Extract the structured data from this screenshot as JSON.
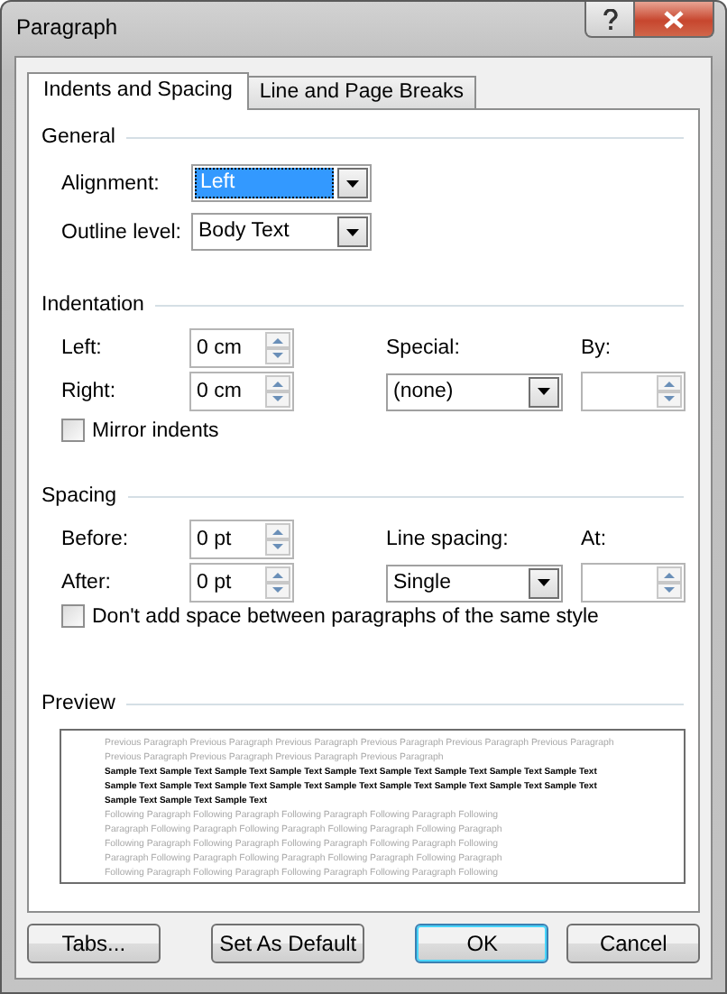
{
  "window": {
    "title": "Paragraph"
  },
  "tabs": [
    {
      "label": "Indents and Spacing",
      "selected": true
    },
    {
      "label": "Line and Page Breaks",
      "selected": false
    }
  ],
  "general": {
    "heading": "General",
    "alignment": {
      "label": "Alignment:",
      "value": "Left",
      "highlighted": true
    },
    "outline_level": {
      "label": "Outline level:",
      "value": "Body Text",
      "highlighted": false
    }
  },
  "indentation": {
    "heading": "Indentation",
    "left": {
      "label": "Left:",
      "value": "0 cm"
    },
    "right": {
      "label": "Right:",
      "value": "0 cm"
    },
    "special": {
      "label": "Special:",
      "value": "(none)"
    },
    "by": {
      "label": "By:"
    },
    "mirror_indents": {
      "label": "Mirror indents",
      "checked": false
    }
  },
  "spacing": {
    "heading": "Spacing",
    "before": {
      "label": "Before:",
      "value": "0 pt"
    },
    "after": {
      "label": "After:",
      "value": "0 pt"
    },
    "line_spacing": {
      "label": "Line spacing:",
      "value": "Single"
    },
    "at": {
      "label": "At:"
    },
    "dont_add_space": {
      "label": "Don't add space between paragraphs of the same style",
      "checked": false
    }
  },
  "preview": {
    "heading": "Preview",
    "lines": [
      {
        "kind": "other",
        "text": "Previous Paragraph Previous Paragraph Previous Paragraph Previous Paragraph Previous Paragraph Previous Paragraph"
      },
      {
        "kind": "other",
        "text": "Previous Paragraph Previous Paragraph Previous Paragraph Previous Paragraph"
      },
      {
        "kind": "sample",
        "text": "Sample Text Sample Text Sample Text Sample Text Sample Text Sample Text Sample Text Sample Text Sample Text"
      },
      {
        "kind": "sample",
        "text": "Sample Text Sample Text Sample Text Sample Text Sample Text Sample Text Sample Text Sample Text Sample Text"
      },
      {
        "kind": "sample",
        "text": "Sample Text Sample Text Sample Text"
      },
      {
        "kind": "other",
        "text": "Following Paragraph Following Paragraph Following Paragraph Following Paragraph Following"
      },
      {
        "kind": "other",
        "text": "Paragraph Following Paragraph Following Paragraph Following Paragraph Following Paragraph"
      },
      {
        "kind": "other",
        "text": "Following Paragraph Following Paragraph Following Paragraph Following Paragraph Following"
      },
      {
        "kind": "other",
        "text": "Paragraph Following Paragraph Following Paragraph Following Paragraph Following Paragraph"
      },
      {
        "kind": "other",
        "text": "Following Paragraph Following Paragraph Following Paragraph Following Paragraph Following"
      }
    ]
  },
  "buttons": [
    {
      "label": "Tabs...",
      "default": false
    },
    {
      "label": "Set As Default",
      "default": false
    },
    {
      "label": "OK",
      "default": true
    },
    {
      "label": "Cancel",
      "default": false
    }
  ]
}
